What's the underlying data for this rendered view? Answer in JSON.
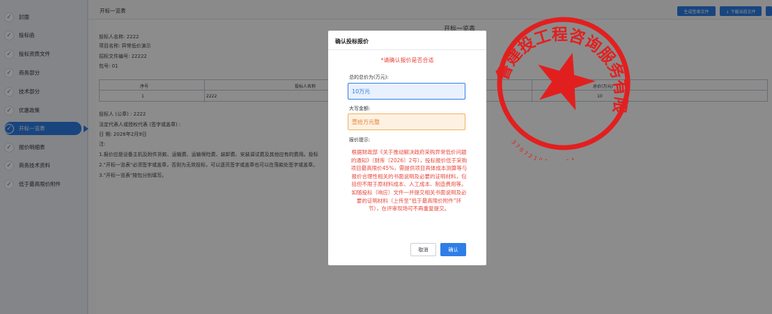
{
  "sidebar": {
    "items": [
      {
        "label": "封面",
        "active": false
      },
      {
        "label": "投标函",
        "active": false
      },
      {
        "label": "投标资质文件",
        "active": false
      },
      {
        "label": "商务部分",
        "active": false
      },
      {
        "label": "技术部分",
        "active": false
      },
      {
        "label": "优惠政策",
        "active": false
      },
      {
        "label": "开标一览表",
        "active": true
      },
      {
        "label": "报价明细表",
        "active": false
      },
      {
        "label": "商务技术资料",
        "active": false
      },
      {
        "label": "低于最高限价附件",
        "active": false
      }
    ]
  },
  "topbar": {
    "title": "开标一览表",
    "btn_generate": "生成签章文件",
    "btn_download": "↓ 下载当前文件"
  },
  "document": {
    "title": "开标一览表",
    "bidder_name": "投标人名称: 2222",
    "project_name": "项目名称: 异常低价演示",
    "file_no": "招标文件编号: 22222",
    "package_no": "包号: 01",
    "table": {
      "headers": [
        "序号",
        "投标人名称",
        "总价(万元)"
      ],
      "rows": [
        [
          "1",
          "2222",
          "10"
        ]
      ]
    },
    "seal_line": "投标人 (公章) : 2222",
    "rep_line": "法定代表人或授权代表 (签字或盖章) :",
    "date_line": "日  期: 2026年2月9日",
    "note_label": "注:",
    "notes": [
      "1.报价应是设备主机及附件货款、运输费、运输保险费、装卸费、安装调试费及其他应有的费用。投标",
      "2.\"开标一览表\"必须签字或盖章，否则为无效投标，可以逐页签字或盖章也可以在落款处签字或盖章。",
      "3.\"开标一览表\"按包分别填写。"
    ]
  },
  "modal": {
    "title": "确认投标报价",
    "warning": "*请确认报价是否合适",
    "total_label": "总的总价为(万元):",
    "total_value": "10万元",
    "capital_label": "大写金额:",
    "capital_value": "壹拾万元整",
    "tip_label": "报价提示:",
    "tip_text": "根据财政部《关于推动解决政府采购异常低价问题的通知》（财库〔2026〕2号），投标报价低于采购项目最高限价45%，需提供项目具体成本测算等与报价合理性相关的书面说明及必要的证明材料，包括但不限于原材料成本、人工成本、制造费用等。如随投标（响应）文件一并提交相关书面说明及必要的证明材料（上传至“低于最高限价附件”环节），在评审现场可不再重复提交。",
    "cancel_label": "取消",
    "ok_label": "确认"
  },
  "seal": {
    "color": "#e21f1f",
    "arc_text": "山东鲁建投工程咨询服务有限公司",
    "code_text": "3707210021984"
  },
  "colors": {
    "accent": "#2f7ee8",
    "warning_red": "#e8463b",
    "seal_red": "#e21f1f"
  }
}
